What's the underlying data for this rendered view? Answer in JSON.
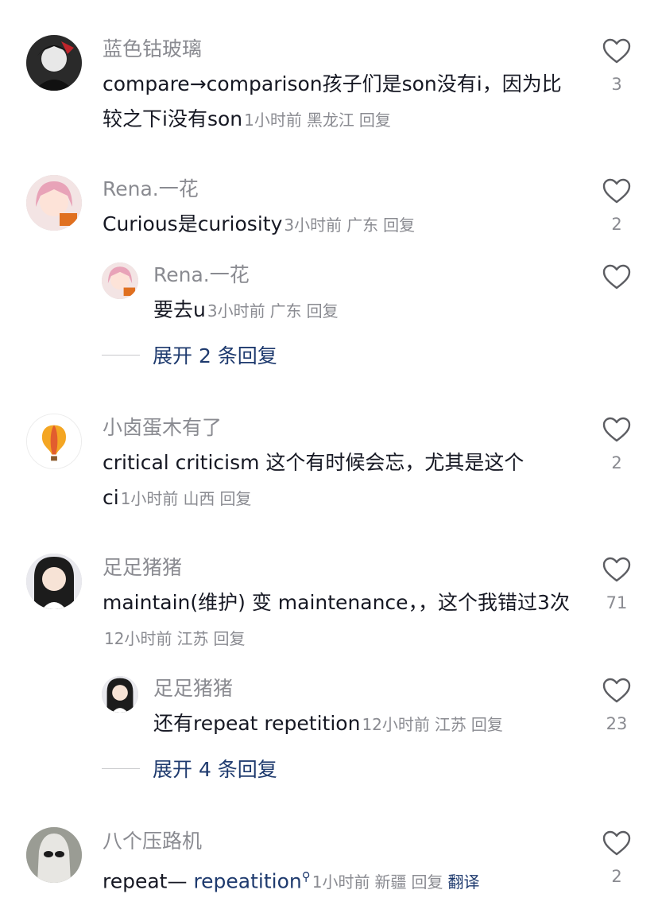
{
  "comments": [
    {
      "username": "蓝色钴玻璃",
      "text": "compare→comparison孩子们是son没有i，因为比较之下i没有son",
      "time": "1小时前",
      "location": "黑龙江",
      "reply_label": "回复",
      "likes": "3"
    },
    {
      "username": "Rena.一花",
      "text": "Curious是curiosity",
      "time": "3小时前",
      "location": "广东",
      "reply_label": "回复",
      "likes": "2",
      "replies": [
        {
          "username": "Rena.一花",
          "text": "要去u",
          "time": "3小时前",
          "location": "广东",
          "reply_label": "回复",
          "likes": ""
        }
      ],
      "expand_label": "展开 2 条回复"
    },
    {
      "username": "小卤蛋木有了",
      "text": "critical criticism 这个有时候会忘，尤其是这个ci",
      "time": "1小时前",
      "location": "山西",
      "reply_label": "回复",
      "likes": "2"
    },
    {
      "username": "足足猪猪",
      "text": "maintain(维护) 变 maintenance，，这个我错过3次",
      "time": "12小时前",
      "location": "江苏",
      "reply_label": "回复",
      "likes": "71",
      "replies": [
        {
          "username": "足足猪猪",
          "text": "还有repeat repetition",
          "time": "12小时前",
          "location": "江苏",
          "reply_label": "回复",
          "likes": "23"
        }
      ],
      "expand_label": "展开 4 条回复"
    },
    {
      "username": "八个压路机",
      "text_prefix": "repeat— ",
      "text_link": "repeatition",
      "time": "1小时前",
      "location": "新疆",
      "reply_label": "回复",
      "translate_label": "翻译",
      "likes": "2"
    }
  ],
  "colors": {
    "primary_text": "#161823",
    "secondary_text": "#8a8b91",
    "link": "#1e3a6e"
  },
  "icons": [
    "heart-outline-icon",
    "search-small-icon"
  ]
}
